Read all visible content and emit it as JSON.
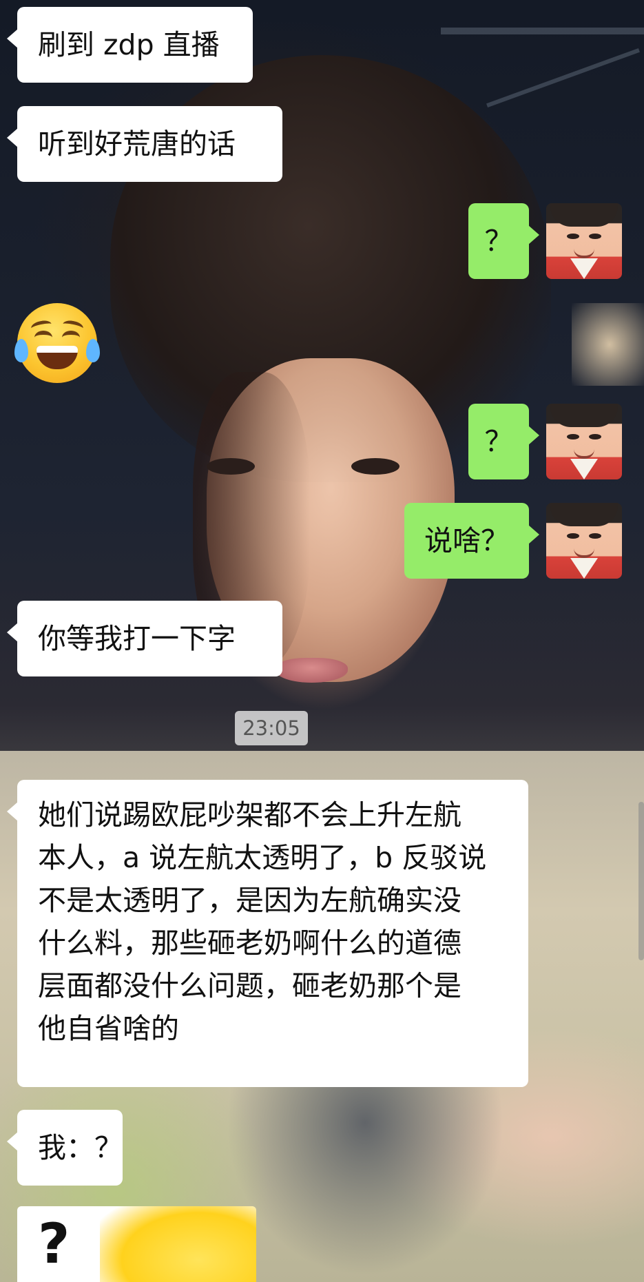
{
  "chat": {
    "messages": [
      {
        "id": "m1",
        "side": "left",
        "type": "text",
        "text": "刷到 zdp 直播"
      },
      {
        "id": "m2",
        "side": "left",
        "type": "text",
        "text": "听到好荒唐的话"
      },
      {
        "id": "m3",
        "side": "right",
        "type": "text",
        "text": "？"
      },
      {
        "id": "m4",
        "side": "left",
        "type": "emoji",
        "emoji": "face-with-tears-of-joy"
      },
      {
        "id": "m5",
        "side": "right",
        "type": "text",
        "text": "？"
      },
      {
        "id": "m6",
        "side": "right",
        "type": "text",
        "text": "说啥？"
      },
      {
        "id": "m7",
        "side": "left",
        "type": "text",
        "text": "你等我打一下字"
      },
      {
        "id": "m8",
        "side": "left",
        "type": "text",
        "lines": [
          "她们说踢欧屁吵架都不会上升左航",
          "本人，a 说左航太透明了，b 反驳说",
          "不是太透明了，是因为左航确实没",
          "什么料，那些砸老奶啊什么的道德",
          "层面都没什么问题，砸老奶那个是",
          "他自省啥的"
        ]
      },
      {
        "id": "m9",
        "side": "left",
        "type": "text",
        "text": "我：？"
      },
      {
        "id": "m10",
        "side": "left",
        "type": "sticker",
        "sticker_text": "?"
      }
    ],
    "timestamp": "23:05"
  },
  "colors": {
    "incoming_bubble": "#ffffff",
    "outgoing_bubble": "#95ec69",
    "timestamp_bg": "#dedede"
  },
  "icons": {
    "avatar": "user-avatar",
    "emoji": "face-with-tears-of-joy-icon"
  }
}
